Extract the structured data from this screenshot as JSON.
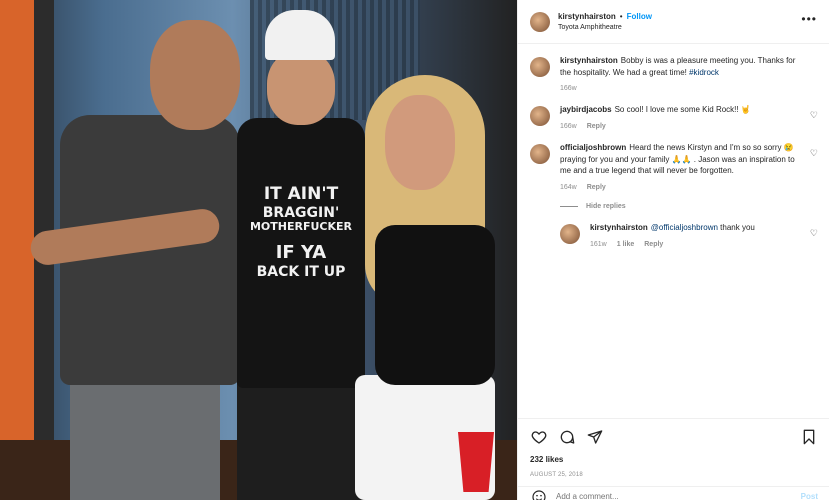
{
  "header": {
    "username": "kirstynhairston",
    "dot": "•",
    "follow_label": "Follow",
    "location": "Toyota Amphitheatre",
    "more_icon": "more-horizontal-icon"
  },
  "shirt": {
    "line1": "IT AIN'T",
    "line2": "BRAGGIN'",
    "line3": "MOTHERFUCKER",
    "line4": "IF YA",
    "line5": "BACK IT UP"
  },
  "comments": [
    {
      "username": "kirstynhairston",
      "text": "Bobby is was a pleasure meeting you. Thanks for the hospitality. We had a great time! ",
      "hashtag": "#kidrock",
      "time": "166w"
    },
    {
      "username": "jaybirdjacobs",
      "text": "So cool! I love me some Kid Rock!! 🤘",
      "time": "166w",
      "reply_label": "Reply"
    },
    {
      "username": "officialjoshbrown",
      "text": "Heard the news Kirstyn and I'm so so sorry 😢 praying for you and your family 🙏🙏 . Jason was an inspiration to me and a true legend that will never be forgotten.",
      "time": "164w",
      "reply_label": "Reply"
    }
  ],
  "hide_replies_label": "Hide replies",
  "reply": {
    "username": "kirstynhairston",
    "mention": "@officialjoshbrown",
    "text": " thank you",
    "time": "161w",
    "likes": "1 like",
    "reply_label": "Reply"
  },
  "actions": {
    "likes": "232 likes",
    "date": "AUGUST 25, 2018"
  },
  "add_comment": {
    "placeholder": "Add a comment...",
    "post_label": "Post"
  }
}
